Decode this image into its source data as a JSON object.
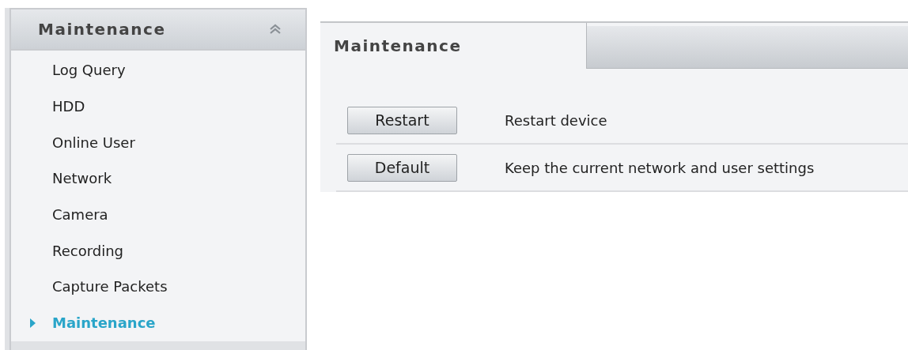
{
  "sidebar": {
    "title": "Maintenance",
    "expanded": true,
    "items": [
      {
        "label": "Log Query",
        "selected": false
      },
      {
        "label": "HDD",
        "selected": false
      },
      {
        "label": "Online User",
        "selected": false
      },
      {
        "label": "Network",
        "selected": false
      },
      {
        "label": "Camera",
        "selected": false
      },
      {
        "label": "Recording",
        "selected": false
      },
      {
        "label": "Capture Packets",
        "selected": false
      },
      {
        "label": "Maintenance",
        "selected": true
      }
    ]
  },
  "tabs": [
    {
      "label": "Maintenance",
      "selected": true
    }
  ],
  "actions": [
    {
      "button": "Restart",
      "description": "Restart device"
    },
    {
      "button": "Default",
      "description": "Keep the current network and user settings"
    }
  ]
}
